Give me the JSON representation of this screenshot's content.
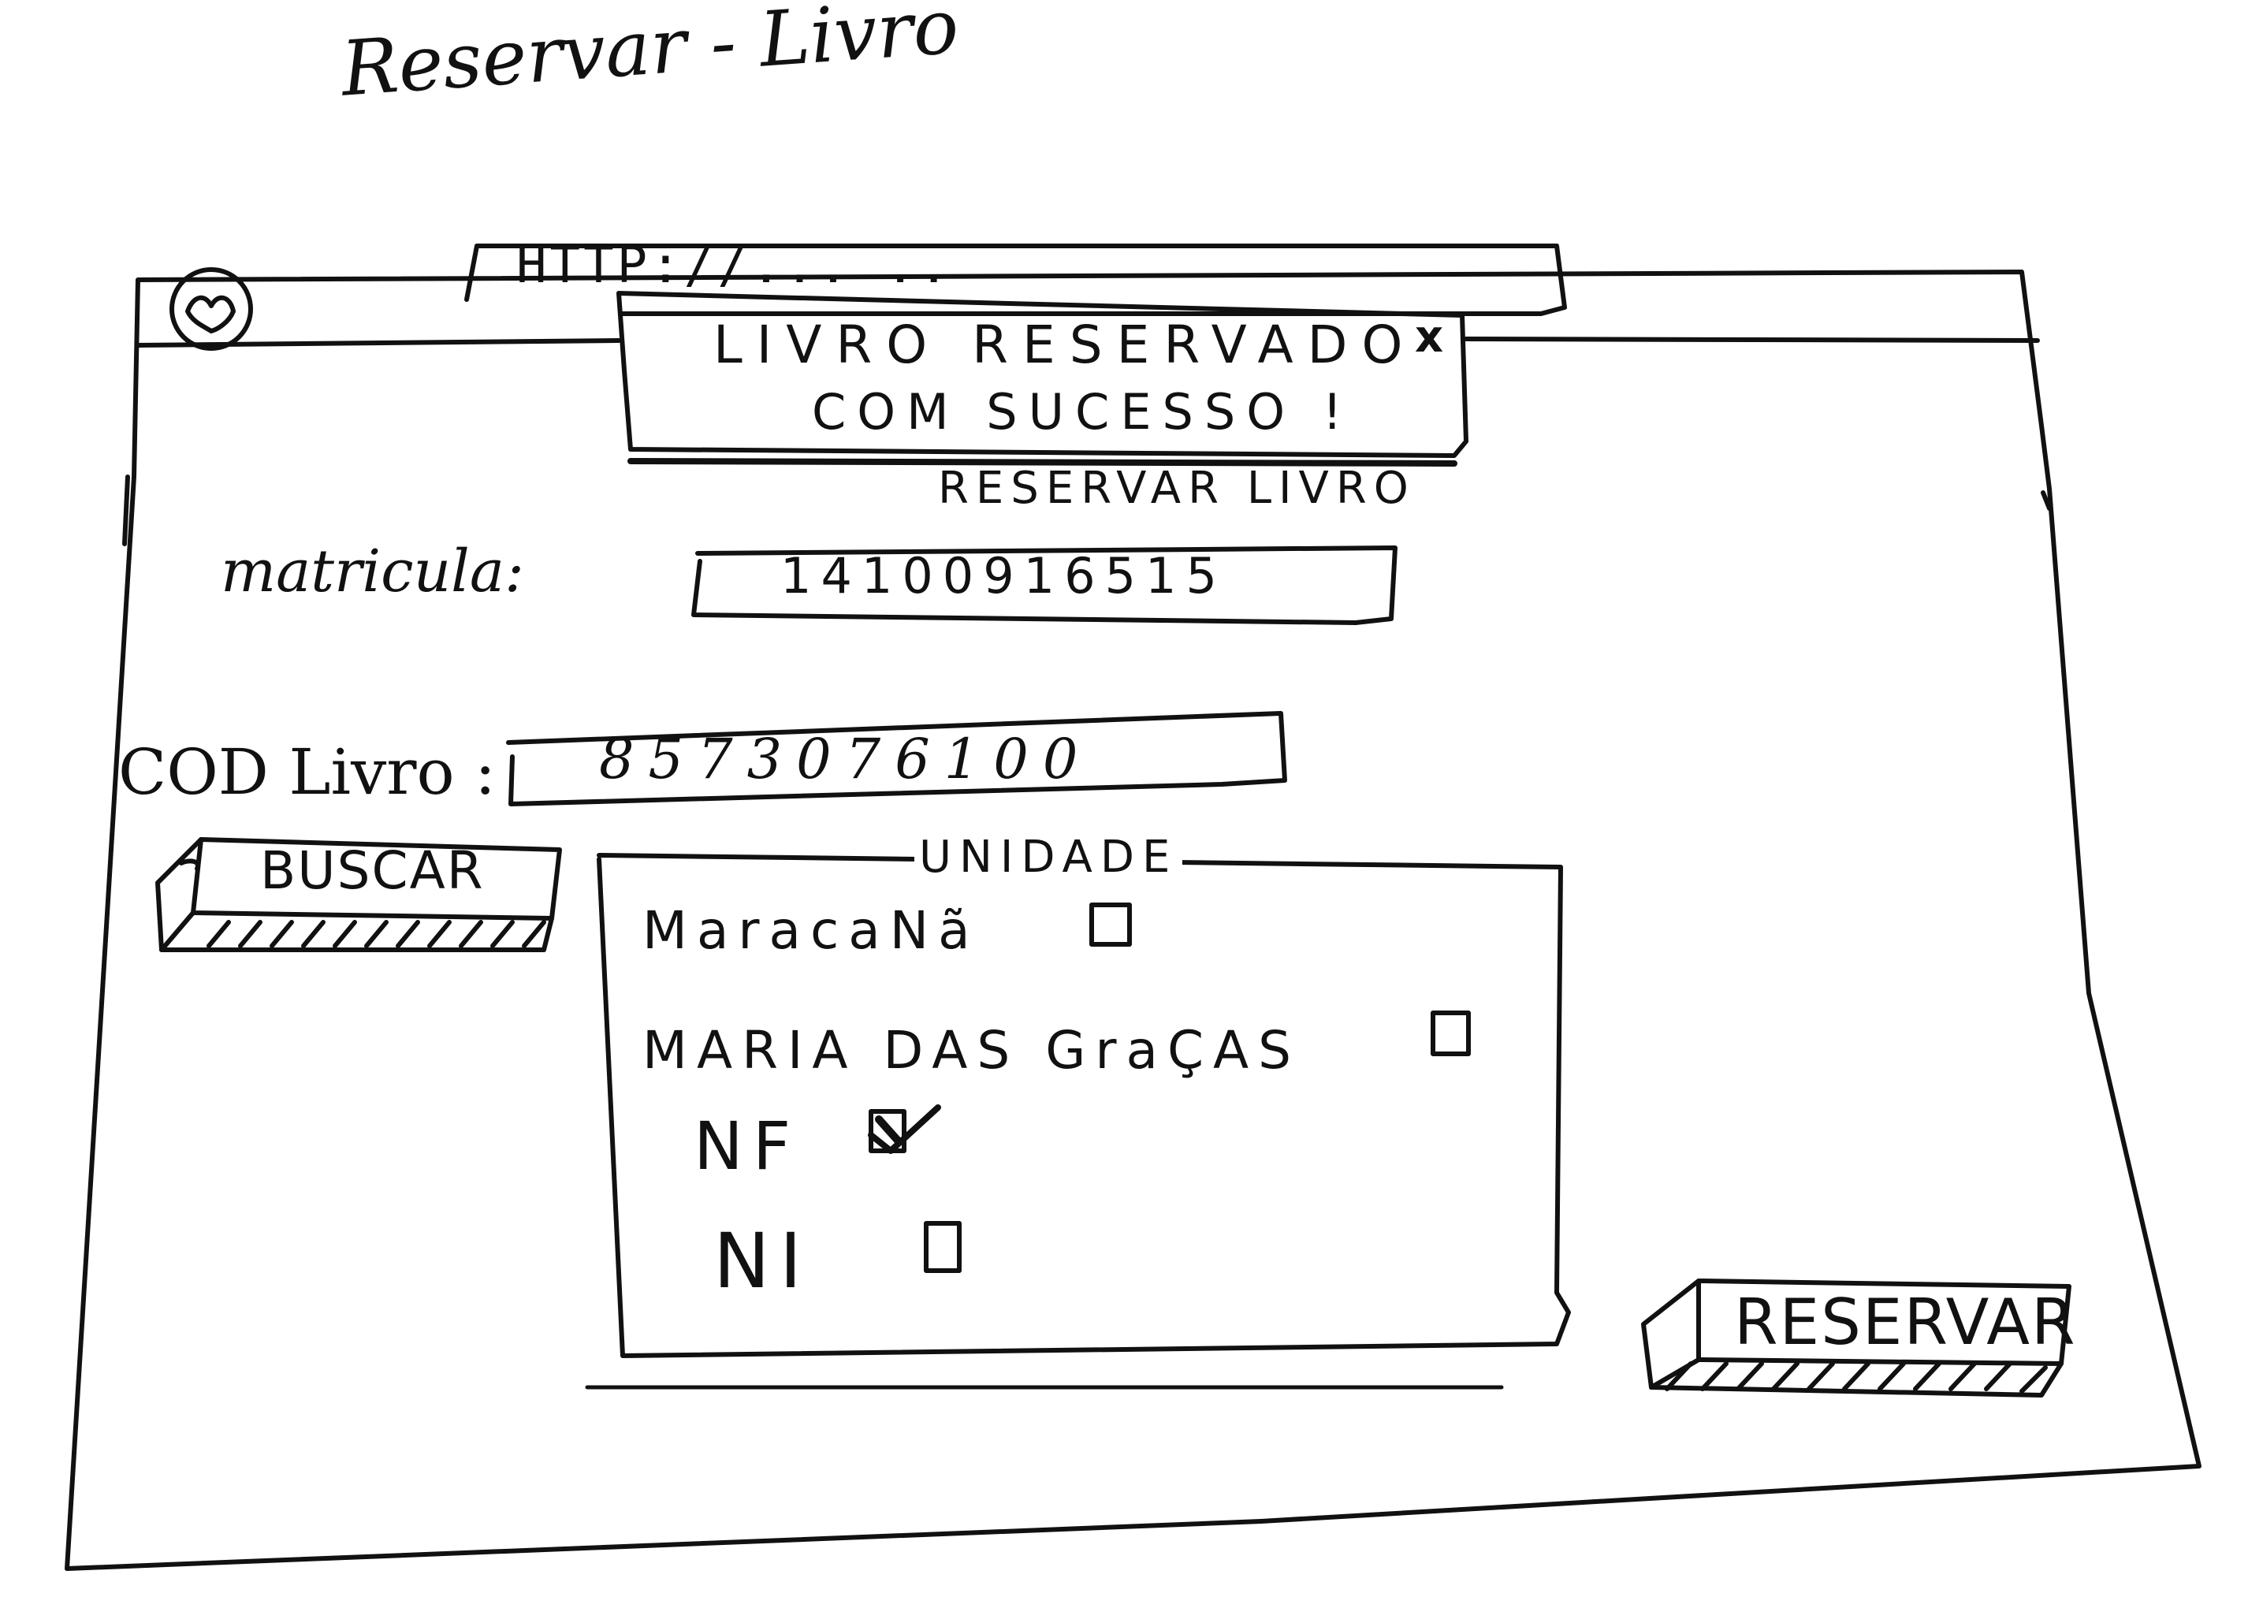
{
  "page_title": "Reservar - Livro",
  "browser": {
    "url": "HTTP://... .."
  },
  "toast": {
    "line1": "LIVRO RESERVADO",
    "line2": "COM SUCESSO !",
    "close_label": "x"
  },
  "form": {
    "title": "RESERVAR LIVRO",
    "matricula": {
      "label": "matricula:",
      "value": "14100916515"
    },
    "cod_livro": {
      "label": "COD Livro :",
      "value": "8573076100"
    },
    "buscar_label": "BUSCAR",
    "unidade": {
      "title": "UNIDADE",
      "options": [
        {
          "label": "MaracaNã",
          "checked": false
        },
        {
          "label": "MARIA DAS GraÇAS",
          "checked": false
        },
        {
          "label": "NF",
          "checked": true
        },
        {
          "label": "NI",
          "checked": false
        }
      ]
    },
    "reservar_label": "RESERVAR"
  }
}
